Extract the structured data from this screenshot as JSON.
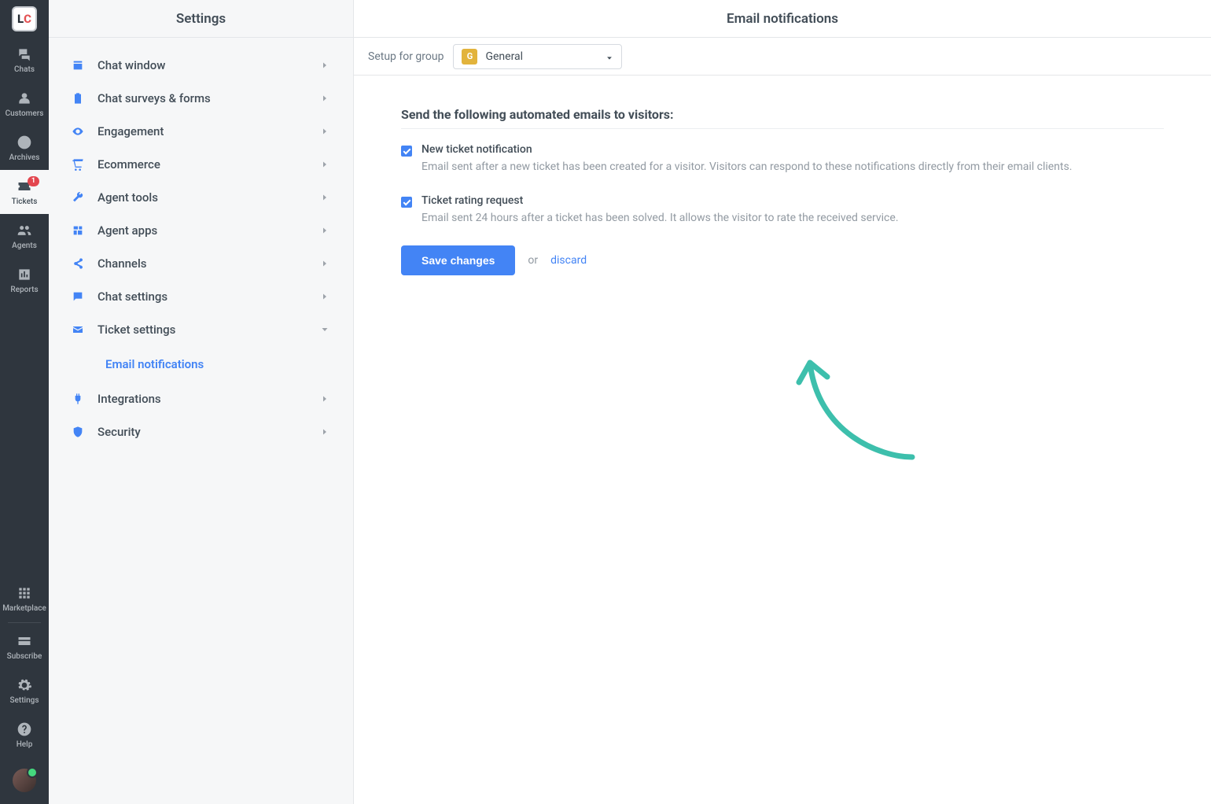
{
  "nav": {
    "chats": "Chats",
    "customers": "Customers",
    "archives": "Archives",
    "tickets": "Tickets",
    "tickets_badge": "1",
    "agents": "Agents",
    "reports": "Reports",
    "marketplace": "Marketplace",
    "subscribe": "Subscribe",
    "settings": "Settings",
    "help": "Help"
  },
  "settings": {
    "title": "Settings",
    "items": [
      {
        "label": "Chat window"
      },
      {
        "label": "Chat surveys & forms"
      },
      {
        "label": "Engagement"
      },
      {
        "label": "Ecommerce"
      },
      {
        "label": "Agent tools"
      },
      {
        "label": "Agent apps"
      },
      {
        "label": "Channels"
      },
      {
        "label": "Chat settings"
      },
      {
        "label": "Ticket settings",
        "expanded": true,
        "sub": "Email notifications"
      },
      {
        "label": "Integrations"
      },
      {
        "label": "Security"
      }
    ]
  },
  "main": {
    "title": "Email notifications",
    "group_label": "Setup for group",
    "group_value": "General",
    "group_avatar": "G",
    "section_title": "Send the following automated emails to visitors:",
    "opt1_title": "New ticket notification",
    "opt1_desc": "Email sent after a new ticket has been created for a visitor. Visitors can respond to these notifications directly from their email clients.",
    "opt2_title": "Ticket rating request",
    "opt2_desc": "Email sent 24 hours after a ticket has been solved. It allows the visitor to rate the received service.",
    "save": "Save changes",
    "or": "or",
    "discard": "discard"
  }
}
